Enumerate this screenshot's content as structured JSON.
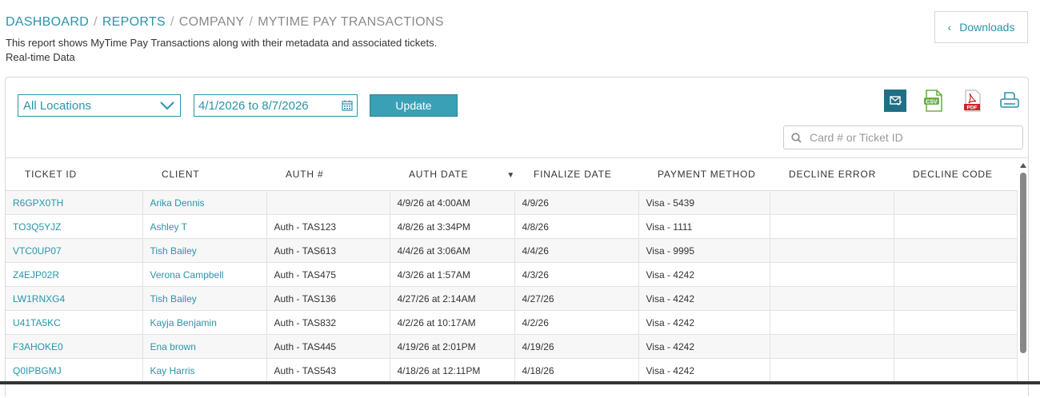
{
  "breadcrumb": {
    "items": [
      "DASHBOARD",
      "REPORTS",
      "COMPANY"
    ],
    "current": "MYTIME PAY TRANSACTIONS",
    "separator": "/"
  },
  "description": "This report shows MyTime Pay Transactions along with their metadata and associated tickets.",
  "realtime_label": "Real-time Data",
  "downloads": {
    "label": "Downloads",
    "icon": "chevron-left-icon"
  },
  "filters": {
    "location": "All Locations",
    "date_range": "4/1/2026 to 8/7/2026",
    "update_label": "Update"
  },
  "toolbar": {
    "icons": [
      "email-report-icon",
      "csv-export-icon",
      "pdf-export-icon",
      "print-icon"
    ],
    "csv_text": "CSV",
    "pdf_text": "PDF"
  },
  "search": {
    "placeholder": "Card # or Ticket ID",
    "value": ""
  },
  "colors": {
    "accent": "#2a94a8",
    "button": "#3aa0b6",
    "pdf_red": "#c9262c",
    "csv_green": "#6ab04c"
  },
  "table": {
    "columns": [
      "TICKET ID",
      "CLIENT",
      "AUTH #",
      "AUTH DATE",
      "FINALIZE DATE",
      "PAYMENT METHOD",
      "DECLINE ERROR",
      "DECLINE CODE"
    ],
    "rows": [
      [
        "R6GPX0TH",
        "Arika Dennis",
        "",
        "4/9/26 at 4:00AM",
        "4/9/26",
        "Visa - 5439",
        "",
        ""
      ],
      [
        "TO3Q5YJZ",
        "Ashley T",
        "Auth - TAS123",
        "4/8/26 at 3:34PM",
        "4/8/26",
        "Visa - 1111",
        "",
        ""
      ],
      [
        "VTC0UP07",
        "Tish Bailey",
        "Auth - TAS613",
        "4/4/26 at 3:06AM",
        "4/4/26",
        "Visa - 9995",
        "",
        ""
      ],
      [
        "Z4EJP02R",
        "Verona Campbell",
        "Auth - TAS475",
        "4/3/26 at 1:57AM",
        "4/3/26",
        "Visa - 4242",
        "",
        ""
      ],
      [
        "LW1RNXG4",
        "Tish Bailey",
        "Auth - TAS136",
        "4/27/26 at 2:14AM",
        "4/27/26",
        "Visa - 4242",
        "",
        ""
      ],
      [
        "U41TA5KC",
        "Kayja Benjamin",
        "Auth - TAS832",
        "4/2/26 at 10:17AM",
        "4/2/26",
        "Visa - 4242",
        "",
        ""
      ],
      [
        "F3AHOKE0",
        "Ena brown",
        "Auth - TAS445",
        "4/19/26 at 2:01PM",
        "4/19/26",
        "Visa - 4242",
        "",
        ""
      ],
      [
        "Q0IPBGMJ",
        "Kay Harris",
        "Auth - TAS543",
        "4/18/26 at 12:11PM",
        "4/18/26",
        "Visa - 4242",
        "",
        ""
      ]
    ]
  }
}
